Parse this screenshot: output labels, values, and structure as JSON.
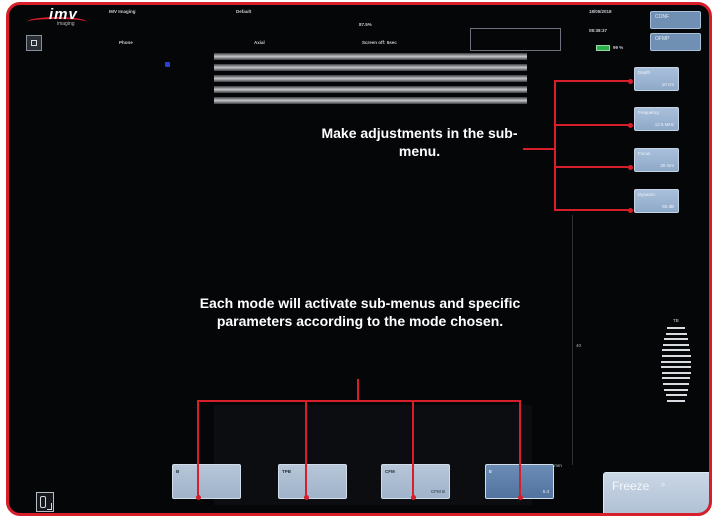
{
  "app": {
    "logo": "imv",
    "logo_sub": "imaging"
  },
  "header": {
    "preset_name": "IMV Imaging",
    "preset_value": "Default",
    "percent": "87.5%",
    "row2_left": "Phone",
    "row2_mid": "Axial",
    "row2_right": "Screen off: 5sec",
    "date": "18/05/2018",
    "time": "08:38:37",
    "battery": "99 %",
    "btn1": "CONF",
    "btn2": "OFMP"
  },
  "parameters": [
    {
      "label": "Depth",
      "value": "10 cm"
    },
    {
      "label": "Frequency",
      "value": "12.5 MHz"
    },
    {
      "label": "Focus",
      "value": "30 mm"
    },
    {
      "label": "Dynamic",
      "value": "65 dB"
    }
  ],
  "scale": {
    "tick": "40",
    "depth_label": "50 mm"
  },
  "tgc_label": "TB",
  "modes": [
    {
      "label": "B",
      "value": ""
    },
    {
      "label": "TPB",
      "value": ""
    },
    {
      "label": "CFM",
      "value": "CFM B"
    },
    {
      "label": "E",
      "value": "5.3"
    }
  ],
  "freeze": {
    "label": "Freeze",
    "arrow": ">"
  },
  "callouts": {
    "top": "Make adjustments in the sub-menu.",
    "bottom": "Each mode will activate sub-menus and specific parameters according to the mode chosen."
  },
  "colors": {
    "accent": "#d81e2a",
    "button": "#9fb3ca",
    "active_button": "#5c7ea9"
  }
}
